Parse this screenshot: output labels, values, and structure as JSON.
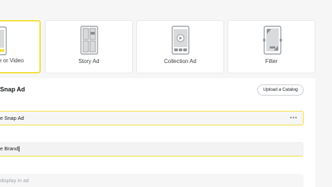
{
  "ad_formats": [
    {
      "label": "Single Image or Video",
      "visible_label": "e or Video",
      "selected": true,
      "icon": "single-image-icon"
    },
    {
      "label": "Story Ad",
      "visible_label": "Story Ad",
      "selected": false,
      "icon": "story-ad-icon"
    },
    {
      "label": "Collection Ad",
      "visible_label": "Collection Ad",
      "selected": false,
      "icon": "collection-ad-icon"
    },
    {
      "label": "Filter",
      "visible_label": "Filter",
      "selected": false,
      "icon": "filter-icon"
    }
  ],
  "section": {
    "title": "Snap Ad",
    "upload_button": "Upload a Catalog"
  },
  "fields": {
    "ad_name": {
      "value": "e Snap Ad",
      "more": "•••"
    },
    "brand_name": {
      "value": "e Brand"
    },
    "headline": {
      "placeholder": "display in ad"
    }
  },
  "colors": {
    "accent": "#f2df3a",
    "border": "#e6e8ea"
  }
}
